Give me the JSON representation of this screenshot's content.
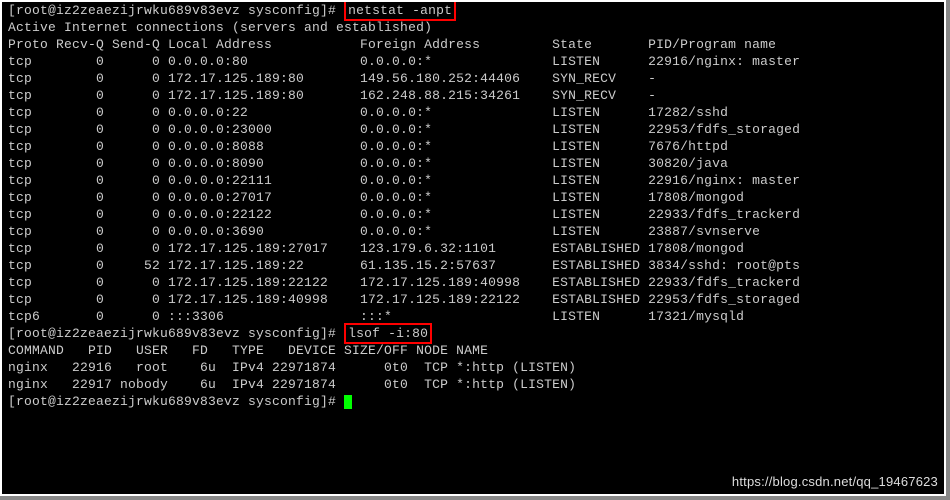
{
  "prompt": "[root@iz2zeaezijrwku689v83evz sysconfig]#",
  "cmd1": "netstat -anpt",
  "hdr": "Active Internet connections (servers and established)",
  "cols": "Proto Recv-Q Send-Q Local Address           Foreign Address         State       PID/Program name",
  "rows": [
    "tcp        0      0 0.0.0.0:80              0.0.0.0:*               LISTEN      22916/nginx: master",
    "tcp        0      0 172.17.125.189:80       149.56.180.252:44406    SYN_RECV    -",
    "tcp        0      0 172.17.125.189:80       162.248.88.215:34261    SYN_RECV    -",
    "tcp        0      0 0.0.0.0:22              0.0.0.0:*               LISTEN      17282/sshd",
    "tcp        0      0 0.0.0.0:23000           0.0.0.0:*               LISTEN      22953/fdfs_storaged",
    "tcp        0      0 0.0.0.0:8088            0.0.0.0:*               LISTEN      7676/httpd",
    "tcp        0      0 0.0.0.0:8090            0.0.0.0:*               LISTEN      30820/java",
    "tcp        0      0 0.0.0.0:22111           0.0.0.0:*               LISTEN      22916/nginx: master",
    "tcp        0      0 0.0.0.0:27017           0.0.0.0:*               LISTEN      17808/mongod",
    "tcp        0      0 0.0.0.0:22122           0.0.0.0:*               LISTEN      22933/fdfs_trackerd",
    "tcp        0      0 0.0.0.0:3690            0.0.0.0:*               LISTEN      23887/svnserve",
    "tcp        0      0 172.17.125.189:27017    123.179.6.32:1101       ESTABLISHED 17808/mongod",
    "tcp        0     52 172.17.125.189:22       61.135.15.2:57637       ESTABLISHED 3834/sshd: root@pts",
    "tcp        0      0 172.17.125.189:22122    172.17.125.189:40998    ESTABLISHED 22933/fdfs_trackerd",
    "tcp        0      0 172.17.125.189:40998    172.17.125.189:22122    ESTABLISHED 22953/fdfs_storaged",
    "tcp6       0      0 :::3306                 :::*                    LISTEN      17321/mysqld"
  ],
  "cmd2": "lsof -i:80",
  "lsof_hdr": "COMMAND   PID   USER   FD   TYPE   DEVICE SIZE/OFF NODE NAME",
  "lsof_rows": [
    "nginx   22916   root    6u  IPv4 22971874      0t0  TCP *:http (LISTEN)",
    "nginx   22917 nobody    6u  IPv4 22971874      0t0  TCP *:http (LISTEN)"
  ],
  "wm": "https://blog.csdn.net/qq_19467623"
}
